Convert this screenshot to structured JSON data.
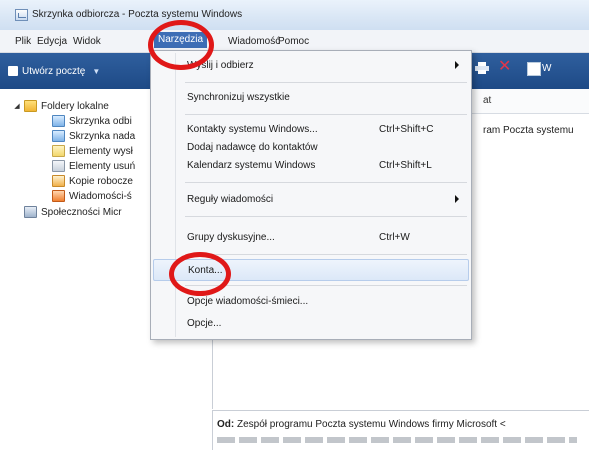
{
  "window": {
    "title": "Skrzynka odbiorcza - Poczta systemu Windows"
  },
  "menubar": {
    "items": [
      "Plik",
      "Edycja",
      "Widok",
      "Narzędzia",
      "Wiadomość",
      "Pomoc"
    ],
    "active": "Narzędzia"
  },
  "toolbar": {
    "new_mail": "Utwórz pocztę",
    "right_label": "W"
  },
  "folders": {
    "root": "Foldery lokalne",
    "items": [
      "Skrzynka odbi",
      "Skrzynka nada",
      "Elementy wysł",
      "Elementy usuń",
      "Kopie robocze",
      "Wiadomości-ś"
    ],
    "community": "Społeczności Micr"
  },
  "list": {
    "header_col": "at",
    "row_cell": "ram Poczta systemu"
  },
  "tools_menu": {
    "items": [
      {
        "label": "Wyślij i odbierz",
        "shortcut": "",
        "submenu": true
      },
      {
        "label": "Synchronizuj wszystkie",
        "shortcut": "",
        "submenu": false
      },
      {
        "label": "Kontakty systemu Windows...",
        "shortcut": "Ctrl+Shift+C",
        "submenu": false
      },
      {
        "label": "Dodaj nadawcę do kontaktów",
        "shortcut": "",
        "submenu": false
      },
      {
        "label": "Kalendarz systemu Windows",
        "shortcut": "Ctrl+Shift+L",
        "submenu": false
      },
      {
        "label": "Reguły wiadomości",
        "shortcut": "",
        "submenu": true
      },
      {
        "label": "Grupy dyskusyjne...",
        "shortcut": "Ctrl+W",
        "submenu": false
      },
      {
        "label": "Konta...",
        "shortcut": "",
        "submenu": false
      },
      {
        "label": "Opcje wiadomości-śmieci...",
        "shortcut": "",
        "submenu": false
      },
      {
        "label": "Opcje...",
        "shortcut": "",
        "submenu": false
      }
    ],
    "hovered": "Konta..."
  },
  "preview": {
    "from_label": "Od:",
    "from_value": "Zespół programu Poczta systemu Windows firmy Microsoft <"
  },
  "colors": {
    "annotation_circle": "#e01818",
    "menu_active": "#3d6db5",
    "toolbar": "#1e4a86"
  }
}
